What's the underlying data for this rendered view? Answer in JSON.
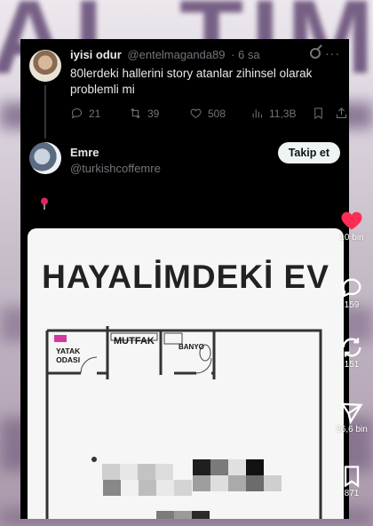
{
  "post": {
    "author_name": "iyisi odur",
    "author_handle": "@entelmaganda89",
    "time": "· 6 sa",
    "text": "80lerdeki hallerini story atanlar zihinsel olarak problemli mi",
    "replies": "21",
    "reposts": "39",
    "likes": "508",
    "views": "11,3B",
    "icons": [
      "reply-icon",
      "repost-icon",
      "heart-icon",
      "views-icon",
      "bookmark-icon",
      "share-icon",
      "grok-icon",
      "more-icon"
    ]
  },
  "reply": {
    "author_name": "Emre",
    "author_handle": "@turkishcoffemre",
    "follow_label": "Takip et"
  },
  "floor_plan": {
    "title": "HAYALİMDEKİ EV",
    "rooms": [
      "YATAK\nODASI",
      "MUTFAK",
      "BANYO"
    ]
  },
  "side_actions": {
    "likes": "10 bin",
    "comments": "159",
    "reposts": "151",
    "shares": "36,6 bin",
    "saves": "871"
  },
  "colors": {
    "screen_bg": "#000000",
    "text": "#e7e9ea",
    "muted": "#71767b",
    "like_red": "#fe2c55",
    "backdrop_purple": "#4a2f5c"
  }
}
